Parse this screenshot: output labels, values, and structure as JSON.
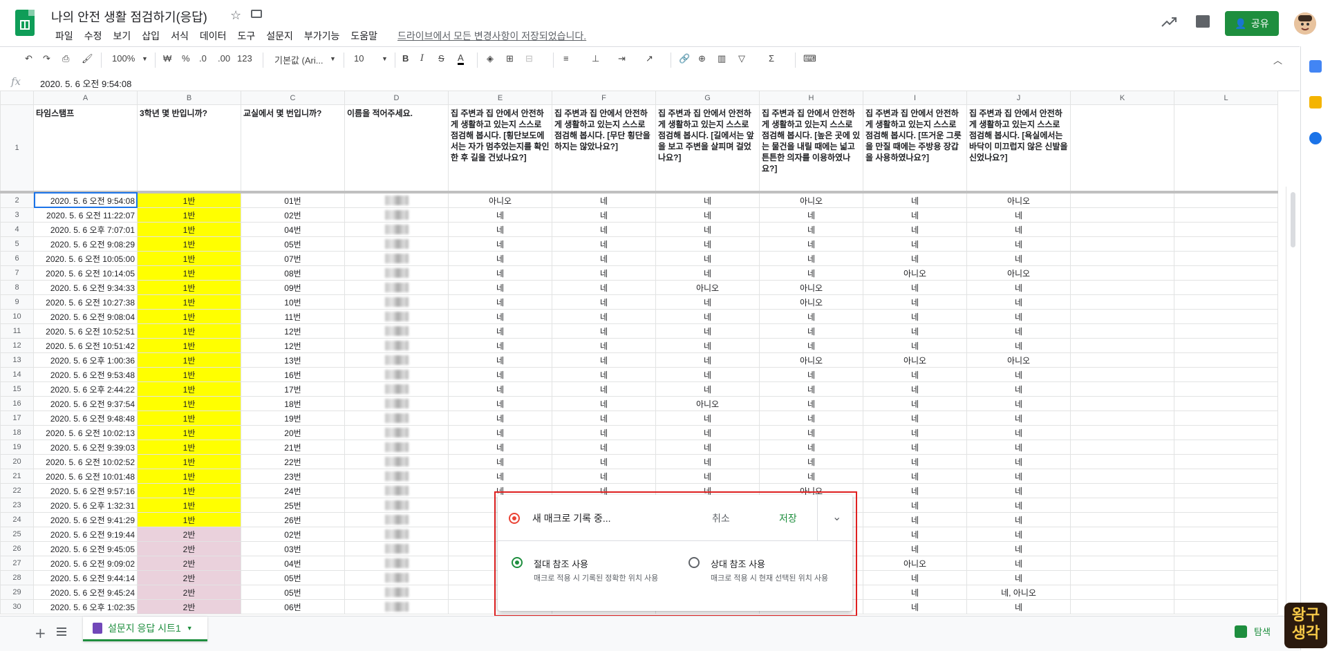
{
  "app": {
    "title": "나의 안전 생활 점검하기(응답)",
    "menus": [
      "파일",
      "수정",
      "보기",
      "삽입",
      "서식",
      "데이터",
      "도구",
      "설문지",
      "부가기능",
      "도움말"
    ],
    "saved_status": "드라이브에서 모든 변경사항이 저장되었습니다.",
    "share_label": "공유"
  },
  "toolbar": {
    "zoom": "100%",
    "currency": "₩",
    "percent": "%",
    "decimal_less": ".0",
    "decimal_more": ".00",
    "format": "123",
    "font": "기본값 (Ari...",
    "font_size": "10"
  },
  "formula_bar": {
    "fx": "fx",
    "value": "2020. 5. 6 오전 9:54:08"
  },
  "columns": [
    "A",
    "B",
    "C",
    "D",
    "E",
    "F",
    "G",
    "H",
    "I",
    "J",
    "K",
    "L"
  ],
  "header_row": {
    "row": "1",
    "cells": [
      "타임스탬프",
      "3학년 몇 반입니까?",
      "교실에서 몇 번입니까?",
      "이름을 적어주세요.",
      "집 주변과 집 안에서 안전하게 생활하고 있는지 스스로 점검해 봅시다. [횡단보도에서는 자가 멈추었는지를 확인한 후 길을 건넜나요?]",
      "집 주변과 집 안에서 안전하게 생활하고 있는지 스스로 점검해 봅시다. [무단 횡단을 하지는 않았나요?]",
      "집 주변과 집 안에서 안전하게 생활하고 있는지 스스로 점검해 봅시다. [길에서는 앞을 보고 주변을 살피며 걸었나요?]",
      "집 주변과 집 안에서 안전하게 생활하고 있는지 스스로 점검해 봅시다. [높은 곳에 있는 물건을 내릴 때에는 넓고 튼튼한 의자를 이용하였나요?]",
      "집 주변과 집 안에서 안전하게 생활하고 있는지 스스로 점검해 봅시다. [뜨거운 그릇을 만질 때에는 주방용 장갑을 사용하였나요?]",
      "집 주변과 집 안에서 안전하게 생활하고 있는지 스스로 점검해 봅시다. [욕실에서는 바닥이 미끄럽지 않은 신발을 신었나요?]",
      "",
      ""
    ]
  },
  "rows": [
    {
      "n": "2",
      "ts": "2020. 5. 6 오전 9:54:08",
      "cls": "1반",
      "num": "01번",
      "e": "아니오",
      "f": "네",
      "g": "네",
      "h": "아니오",
      "i": "네",
      "j": "아니오"
    },
    {
      "n": "3",
      "ts": "2020. 5. 6 오전 11:22:07",
      "cls": "1반",
      "num": "02번",
      "e": "네",
      "f": "네",
      "g": "네",
      "h": "네",
      "i": "네",
      "j": "네"
    },
    {
      "n": "4",
      "ts": "2020. 5. 6 오후 7:07:01",
      "cls": "1반",
      "num": "04번",
      "e": "네",
      "f": "네",
      "g": "네",
      "h": "네",
      "i": "네",
      "j": "네"
    },
    {
      "n": "5",
      "ts": "2020. 5. 6 오전 9:08:29",
      "cls": "1반",
      "num": "05번",
      "e": "네",
      "f": "네",
      "g": "네",
      "h": "네",
      "i": "네",
      "j": "네"
    },
    {
      "n": "6",
      "ts": "2020. 5. 6 오전 10:05:00",
      "cls": "1반",
      "num": "07번",
      "e": "네",
      "f": "네",
      "g": "네",
      "h": "네",
      "i": "네",
      "j": "네"
    },
    {
      "n": "7",
      "ts": "2020. 5. 6 오전 10:14:05",
      "cls": "1반",
      "num": "08번",
      "e": "네",
      "f": "네",
      "g": "네",
      "h": "네",
      "i": "아니오",
      "j": "아니오"
    },
    {
      "n": "8",
      "ts": "2020. 5. 6 오전 9:34:33",
      "cls": "1반",
      "num": "09번",
      "e": "네",
      "f": "네",
      "g": "아니오",
      "h": "아니오",
      "i": "네",
      "j": "네"
    },
    {
      "n": "9",
      "ts": "2020. 5. 6 오전 10:27:38",
      "cls": "1반",
      "num": "10번",
      "e": "네",
      "f": "네",
      "g": "네",
      "h": "아니오",
      "i": "네",
      "j": "네"
    },
    {
      "n": "10",
      "ts": "2020. 5. 6 오전 9:08:04",
      "cls": "1반",
      "num": "11번",
      "e": "네",
      "f": "네",
      "g": "네",
      "h": "네",
      "i": "네",
      "j": "네"
    },
    {
      "n": "11",
      "ts": "2020. 5. 6 오전 10:52:51",
      "cls": "1반",
      "num": "12번",
      "e": "네",
      "f": "네",
      "g": "네",
      "h": "네",
      "i": "네",
      "j": "네"
    },
    {
      "n": "12",
      "ts": "2020. 5. 6 오전 10:51:42",
      "cls": "1반",
      "num": "12번",
      "e": "네",
      "f": "네",
      "g": "네",
      "h": "네",
      "i": "네",
      "j": "네"
    },
    {
      "n": "13",
      "ts": "2020. 5. 6 오후 1:00:36",
      "cls": "1반",
      "num": "13번",
      "e": "네",
      "f": "네",
      "g": "네",
      "h": "아니오",
      "i": "아니오",
      "j": "아니오"
    },
    {
      "n": "14",
      "ts": "2020. 5. 6 오전 9:53:48",
      "cls": "1반",
      "num": "16번",
      "e": "네",
      "f": "네",
      "g": "네",
      "h": "네",
      "i": "네",
      "j": "네"
    },
    {
      "n": "15",
      "ts": "2020. 5. 6 오후 2:44:22",
      "cls": "1반",
      "num": "17번",
      "e": "네",
      "f": "네",
      "g": "네",
      "h": "네",
      "i": "네",
      "j": "네"
    },
    {
      "n": "16",
      "ts": "2020. 5. 6 오전 9:37:54",
      "cls": "1반",
      "num": "18번",
      "e": "네",
      "f": "네",
      "g": "아니오",
      "h": "네",
      "i": "네",
      "j": "네"
    },
    {
      "n": "17",
      "ts": "2020. 5. 6 오전 9:48:48",
      "cls": "1반",
      "num": "19번",
      "e": "네",
      "f": "네",
      "g": "네",
      "h": "네",
      "i": "네",
      "j": "네"
    },
    {
      "n": "18",
      "ts": "2020. 5. 6 오전 10:02:13",
      "cls": "1반",
      "num": "20번",
      "e": "네",
      "f": "네",
      "g": "네",
      "h": "네",
      "i": "네",
      "j": "네"
    },
    {
      "n": "19",
      "ts": "2020. 5. 6 오전 9:39:03",
      "cls": "1반",
      "num": "21번",
      "e": "네",
      "f": "네",
      "g": "네",
      "h": "네",
      "i": "네",
      "j": "네"
    },
    {
      "n": "20",
      "ts": "2020. 5. 6 오전 10:02:52",
      "cls": "1반",
      "num": "22번",
      "e": "네",
      "f": "네",
      "g": "네",
      "h": "네",
      "i": "네",
      "j": "네"
    },
    {
      "n": "21",
      "ts": "2020. 5. 6 오전 10:01:48",
      "cls": "1반",
      "num": "23번",
      "e": "네",
      "f": "네",
      "g": "네",
      "h": "네",
      "i": "네",
      "j": "네"
    },
    {
      "n": "22",
      "ts": "2020. 5. 6 오전 9:57:16",
      "cls": "1반",
      "num": "24번",
      "e": "네",
      "f": "네",
      "g": "네",
      "h": "아니오",
      "i": "네",
      "j": "네"
    },
    {
      "n": "23",
      "ts": "2020. 5. 6 오후 1:32:31",
      "cls": "1반",
      "num": "25번",
      "e": "",
      "f": "",
      "g": "",
      "h": "",
      "i": "네",
      "j": "네"
    },
    {
      "n": "24",
      "ts": "2020. 5. 6 오전 9:41:29",
      "cls": "1반",
      "num": "26번",
      "e": "",
      "f": "",
      "g": "",
      "h": "",
      "i": "네",
      "j": "네"
    },
    {
      "n": "25",
      "ts": "2020. 5. 6 오전 9:19:44",
      "cls": "2반",
      "num": "02번",
      "e": "",
      "f": "",
      "g": "",
      "h": "",
      "i": "네",
      "j": "네"
    },
    {
      "n": "26",
      "ts": "2020. 5. 6 오전 9:45:05",
      "cls": "2반",
      "num": "03번",
      "e": "",
      "f": "",
      "g": "",
      "h": "",
      "i": "네",
      "j": "네"
    },
    {
      "n": "27",
      "ts": "2020. 5. 6 오전 9:09:02",
      "cls": "2반",
      "num": "04번",
      "e": "",
      "f": "",
      "g": "",
      "h": "",
      "i": "아니오",
      "j": "네"
    },
    {
      "n": "28",
      "ts": "2020. 5. 6 오전 9:44:14",
      "cls": "2반",
      "num": "05번",
      "e": "",
      "f": "",
      "g": "",
      "h": "",
      "i": "네",
      "j": "네"
    },
    {
      "n": "29",
      "ts": "2020. 5. 6 오전 9:45:24",
      "cls": "2반",
      "num": "05번",
      "e": "",
      "f": "",
      "g": "",
      "h": "",
      "i": "네",
      "j": "네, 아니오"
    },
    {
      "n": "30",
      "ts": "2020. 5. 6 오후 1:02:35",
      "cls": "2반",
      "num": "06번",
      "e": "",
      "f": "",
      "g": "",
      "h": "",
      "i": "네",
      "j": "네"
    }
  ],
  "macro_dialog": {
    "recording": "새 매크로 기록 중...",
    "cancel": "취소",
    "save": "저장",
    "absolute_title": "절대 참조 사용",
    "absolute_desc": "매크로 적용 시 기록된 정확한 위치 사용",
    "relative_title": "상대 참조 사용",
    "relative_desc": "매크로 적용 시 현재 선택된 위치 사용",
    "selected": "absolute"
  },
  "bottom": {
    "sheet_tab": "설문지 응답 시트1",
    "explore": "탐색"
  },
  "watermark": "왕구\n생각",
  "colors": {
    "green": "#1e8e3e",
    "class1": "#ffff00",
    "class2": "#ead1dc",
    "record": "#ea4335"
  }
}
